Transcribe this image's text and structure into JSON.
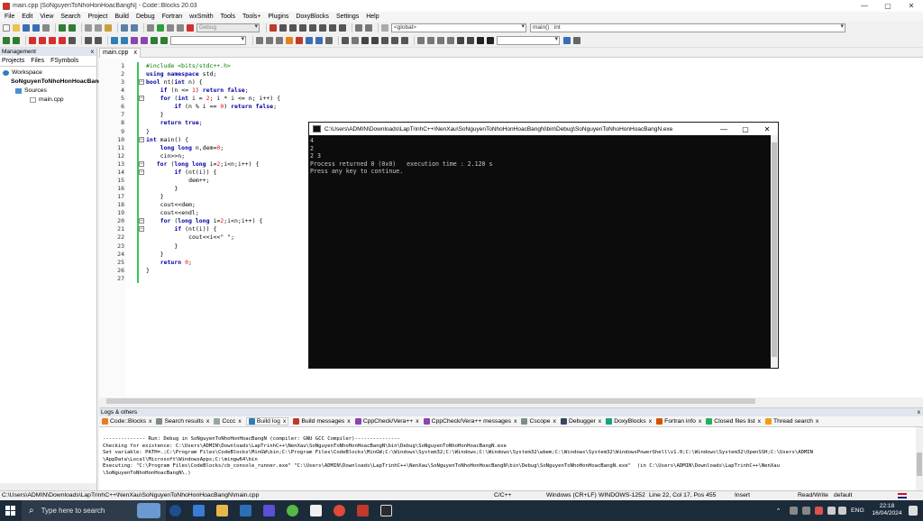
{
  "window": {
    "title": "main.cpp [SoNguyenToNhoHonHoacBangN] - Code::Blocks 20.03",
    "min_glyph": "—",
    "max_glyph": "▢",
    "close_glyph": "✕"
  },
  "menu": [
    "File",
    "Edit",
    "View",
    "Search",
    "Project",
    "Build",
    "Debug",
    "Fortran",
    "wxSmith",
    "Tools",
    "Tools+",
    "Plugins",
    "DoxyBlocks",
    "Settings",
    "Help"
  ],
  "toolbar": {
    "build_target": "Debug",
    "scope": "<global>",
    "symbol": "main() : int"
  },
  "management": {
    "title": "Management",
    "close": "x",
    "tabs": [
      "Projects",
      "Files",
      "FSymbols"
    ],
    "tree": {
      "workspace": "Workspace",
      "project": "SoNguyenToNhoHonHoacBangN",
      "sources": "Sources",
      "file": "main.cpp"
    }
  },
  "editor": {
    "tab_label": "main.cpp",
    "tab_close": "x",
    "line_numbers": [
      "1",
      "2",
      "3",
      "4",
      "5",
      "6",
      "7",
      "8",
      "9",
      "10",
      "11",
      "12",
      "13",
      "14",
      "15",
      "16",
      "17",
      "18",
      "19",
      "20",
      "21",
      "22",
      "23",
      "24",
      "25",
      "26",
      "27"
    ],
    "code": [
      "#include <bits/stdc++.h>",
      "using namespace std;",
      "bool nt(int n) {",
      "    if (n <= 1) return false;",
      "    for (int i = 2; i * i <= n; i++) {",
      "        if (n % i == 0) return false;",
      "    }",
      "    return true;",
      "}",
      "int main() {",
      "    long long n,dem=0;",
      "    cin>>n;",
      "   for (long long i=2;i<n;i++) {",
      "        if (nt(i)) {",
      "            dem++;",
      "        }",
      "    }",
      "    cout<<dem;",
      "    cout<<endl;",
      "    for (long long i=2;i<n;i++) {",
      "        if (nt(i)) {",
      "            cout<<i<<\" \";",
      "        }",
      "    }",
      "    return 0;",
      "}",
      ""
    ]
  },
  "console": {
    "title": "C:\\Users\\ADMIN\\Downloads\\LapTrinhC++\\NenXau\\SoNguyenToNhoHonHoacBangN\\bin\\Debug\\SoNguyenToNhoHonHoacBangN.exe",
    "lines": [
      "4",
      "2",
      "2 3",
      "Process returned 0 (0x0)   execution time : 2.120 s",
      "Press any key to continue."
    ]
  },
  "logs": {
    "title": "Logs & others",
    "close": "x",
    "tabs": [
      {
        "label": "Code::Blocks",
        "color": "#e67e22"
      },
      {
        "label": "Search results",
        "color": "#7f8c8d"
      },
      {
        "label": "Cccc",
        "color": "#95a5a6"
      },
      {
        "label": "Build log",
        "color": "#2980b9"
      },
      {
        "label": "Build messages",
        "color": "#c0392b"
      },
      {
        "label": "CppCheck/Vera++",
        "color": "#8e44ad"
      },
      {
        "label": "CppCheck/Vera++ messages",
        "color": "#8e44ad"
      },
      {
        "label": "Cscope",
        "color": "#7f8c8d"
      },
      {
        "label": "Debugger",
        "color": "#34495e"
      },
      {
        "label": "DoxyBlocks",
        "color": "#16a085"
      },
      {
        "label": "Fortran info",
        "color": "#d35400"
      },
      {
        "label": "Closed files list",
        "color": "#27ae60"
      },
      {
        "label": "Thread search",
        "color": "#f39c12"
      }
    ],
    "tab_close": "x",
    "lines": [
      "-------------- Run: Debug in SoNguyenToNhoHonHoacBangN (compiler: GNU GCC Compiler)---------------",
      "Checking for existence: C:\\Users\\ADMIN\\Downloads\\LapTrinhC++\\NenXau\\SoNguyenToNhoHonHoacBangN\\bin\\Debug\\SoNguyenToNhoHonHoacBangN.exe",
      "Set variable: PATH=.;C:\\Program Files\\CodeBlocks\\MinGW\\bin;C:\\Program Files\\CodeBlocks\\MinGW;C:\\Windows\\System32;C:\\Windows;C:\\Windows\\System32\\wbem;C:\\Windows\\System32\\WindowsPowerShell\\v1.0;C:\\Windows\\System32\\OpenSSH;C:\\Users\\ADMIN",
      "\\AppData\\Local\\Microsoft\\WindowsApps;C:\\mingw64\\bin",
      "Executing: \"C:\\Program Files\\CodeBlocks/cb_console_runner.exe\" \"C:\\Users\\ADMIN\\Downloads\\LapTrinhC++\\NenXau\\SoNguyenToNhoHonHoacBangN\\bin\\Debug\\SoNguyenToNhoHonHoacBangN.exe\"  (in C:\\Users\\ADMIN\\Downloads\\LapTrinhC++\\NenXau",
      "\\SoNguyenToNhoHonHoacBangN\\.)"
    ]
  },
  "status": {
    "path": "C:\\Users\\ADMIN\\Downloads\\LapTrinhC++\\NenXau\\SoNguyenToNhoHonHoacBangN\\main.cpp",
    "language": "C/C++",
    "line_endings": "Windows (CR+LF)",
    "encoding": "WINDOWS-1252",
    "position": "Line 22, Col 17, Pos 455",
    "mode": "Insert",
    "access": "Read/Write",
    "profile": "default"
  },
  "taskbar": {
    "search_placeholder": "Type here to search",
    "language": "ENG",
    "time": "22:18",
    "date": "16/04/2024"
  },
  "colors": {
    "accent": "#0078d7",
    "modified_bar": "#35c85a",
    "keyword": "#0000a0",
    "preprocessor": "#008000",
    "number": "#ff0000"
  }
}
